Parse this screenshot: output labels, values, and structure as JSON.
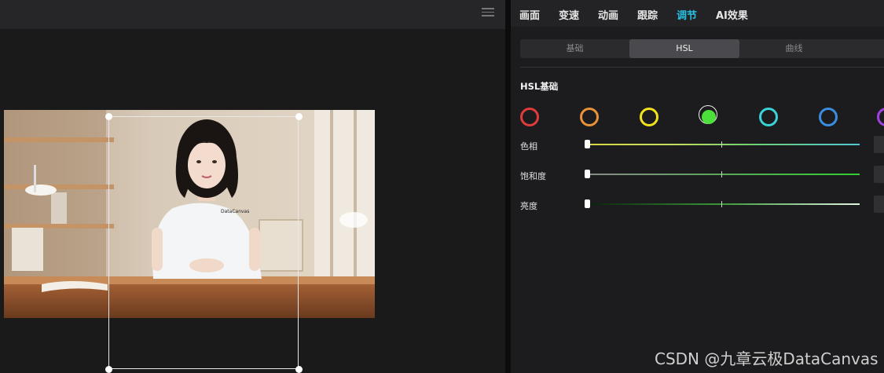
{
  "tabs": [
    {
      "label": "画面",
      "active": false
    },
    {
      "label": "变速",
      "active": false
    },
    {
      "label": "动画",
      "active": false
    },
    {
      "label": "跟踪",
      "active": false
    },
    {
      "label": "调节",
      "active": true
    },
    {
      "label": "AI效果",
      "active": false
    }
  ],
  "segments": [
    {
      "label": "基础",
      "active": false
    },
    {
      "label": "HSL",
      "active": true
    },
    {
      "label": "曲线",
      "active": false
    }
  ],
  "hsl": {
    "title": "HSL基础",
    "swatches": [
      {
        "name": "red",
        "color": "#e03c3c"
      },
      {
        "name": "orange",
        "color": "#e8923a"
      },
      {
        "name": "yellow",
        "color": "#f2e21c"
      },
      {
        "name": "green",
        "color": "#4ce03a",
        "selected": true
      },
      {
        "name": "cyan",
        "color": "#38d4d8"
      },
      {
        "name": "blue",
        "color": "#3a8ee0"
      },
      {
        "name": "purple",
        "color": "#a040e0"
      }
    ],
    "sliders": [
      {
        "label": "色相",
        "value": 0
      },
      {
        "label": "饱和度",
        "value": 0
      },
      {
        "label": "亮度",
        "value": 0
      }
    ]
  },
  "preview": {
    "shirt_logo": "DataCanvas"
  },
  "watermark": "CSDN @九章云极DataCanvas"
}
